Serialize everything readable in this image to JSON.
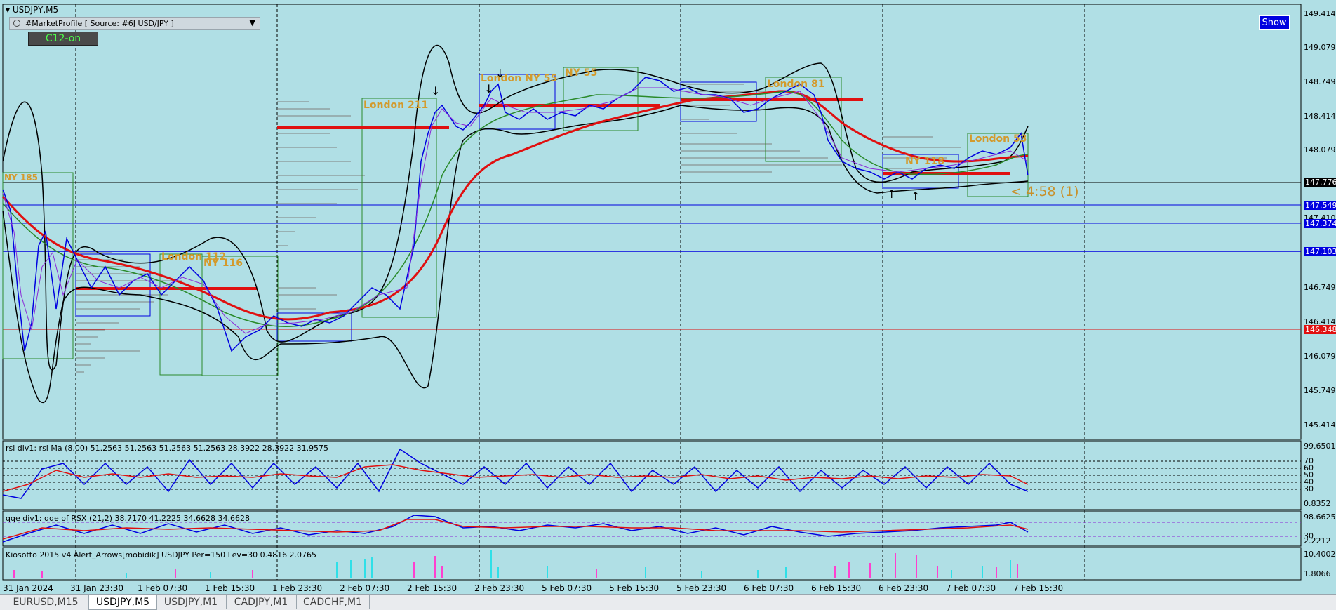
{
  "window": {
    "symbol_title": "USDJPY,M5"
  },
  "indicator_bar": {
    "label": "#MarketProfile [ Source: #6J USD/JPY ]"
  },
  "c12_label": "C12-on",
  "show_button": "Show",
  "countdown": "< 4:58 (1)",
  "sessions": [
    "NY 185",
    "London 211",
    "London NY 55",
    "London 112",
    "NY 116",
    "NY 55",
    "London 81",
    "NY 118",
    "London 53"
  ],
  "price_axis": [
    "149.414",
    "149.079",
    "148.749",
    "148.414",
    "148.079",
    "147.410",
    "146.749",
    "146.414",
    "146.079",
    "145.749",
    "145.414"
  ],
  "price_tags": [
    {
      "value": "147.776",
      "bg": "#000000"
    },
    {
      "value": "147.549",
      "bg": "#0000e0"
    },
    {
      "value": "147.374",
      "bg": "#0000e0"
    },
    {
      "value": "147.103",
      "bg": "#0000e0"
    },
    {
      "value": "146.348",
      "bg": "#e01010"
    }
  ],
  "time_axis": [
    "31 Jan 2024",
    "31 Jan 23:30",
    "1 Feb 07:30",
    "1 Feb 15:30",
    "1 Feb 23:30",
    "2 Feb 07:30",
    "2 Feb 15:30",
    "2 Feb 23:30",
    "5 Feb 07:30",
    "5 Feb 15:30",
    "5 Feb 23:30",
    "6 Feb 07:30",
    "6 Feb 15:30",
    "6 Feb 23:30",
    "7 Feb 07:30",
    "7 Feb 15:30"
  ],
  "rsi_panel": {
    "label": "rsi div1: rsi Ma (8.00) 51.2563 51.2563 51.2563 51.2563 28.3922 28.3922 31.9575",
    "axis": [
      "99.6501",
      "70",
      "60",
      "50",
      "40",
      "30",
      "0.8352"
    ]
  },
  "qqe_panel": {
    "label": "qqe div1: qqe of RSX (21,2) 38.7170 41.2225 34.6628 34.6628",
    "axis": [
      "98.6625",
      "30",
      "2.2212"
    ]
  },
  "kiosotto_panel": {
    "label": "Kiosotto 2015 v4 Alert_Arrows[mobidik] USDJPY Per=150 Lev=30 0.4816 2.0765",
    "axis": [
      "10.4002",
      "1.8066"
    ]
  },
  "tabs": [
    {
      "label": "EURUSD,M15",
      "active": false
    },
    {
      "label": "USDJPY,M5",
      "active": true
    },
    {
      "label": "USDJPY,M1",
      "active": false
    },
    {
      "label": "CADJPY,M1",
      "active": false
    },
    {
      "label": "CADCHF,M1",
      "active": false
    }
  ],
  "colors": {
    "background": "#b0dfe5",
    "red_line": "#e01010",
    "blue_line": "#0000e0",
    "magenta": "#ff3fcf",
    "cyan": "#2fe0e8"
  }
}
